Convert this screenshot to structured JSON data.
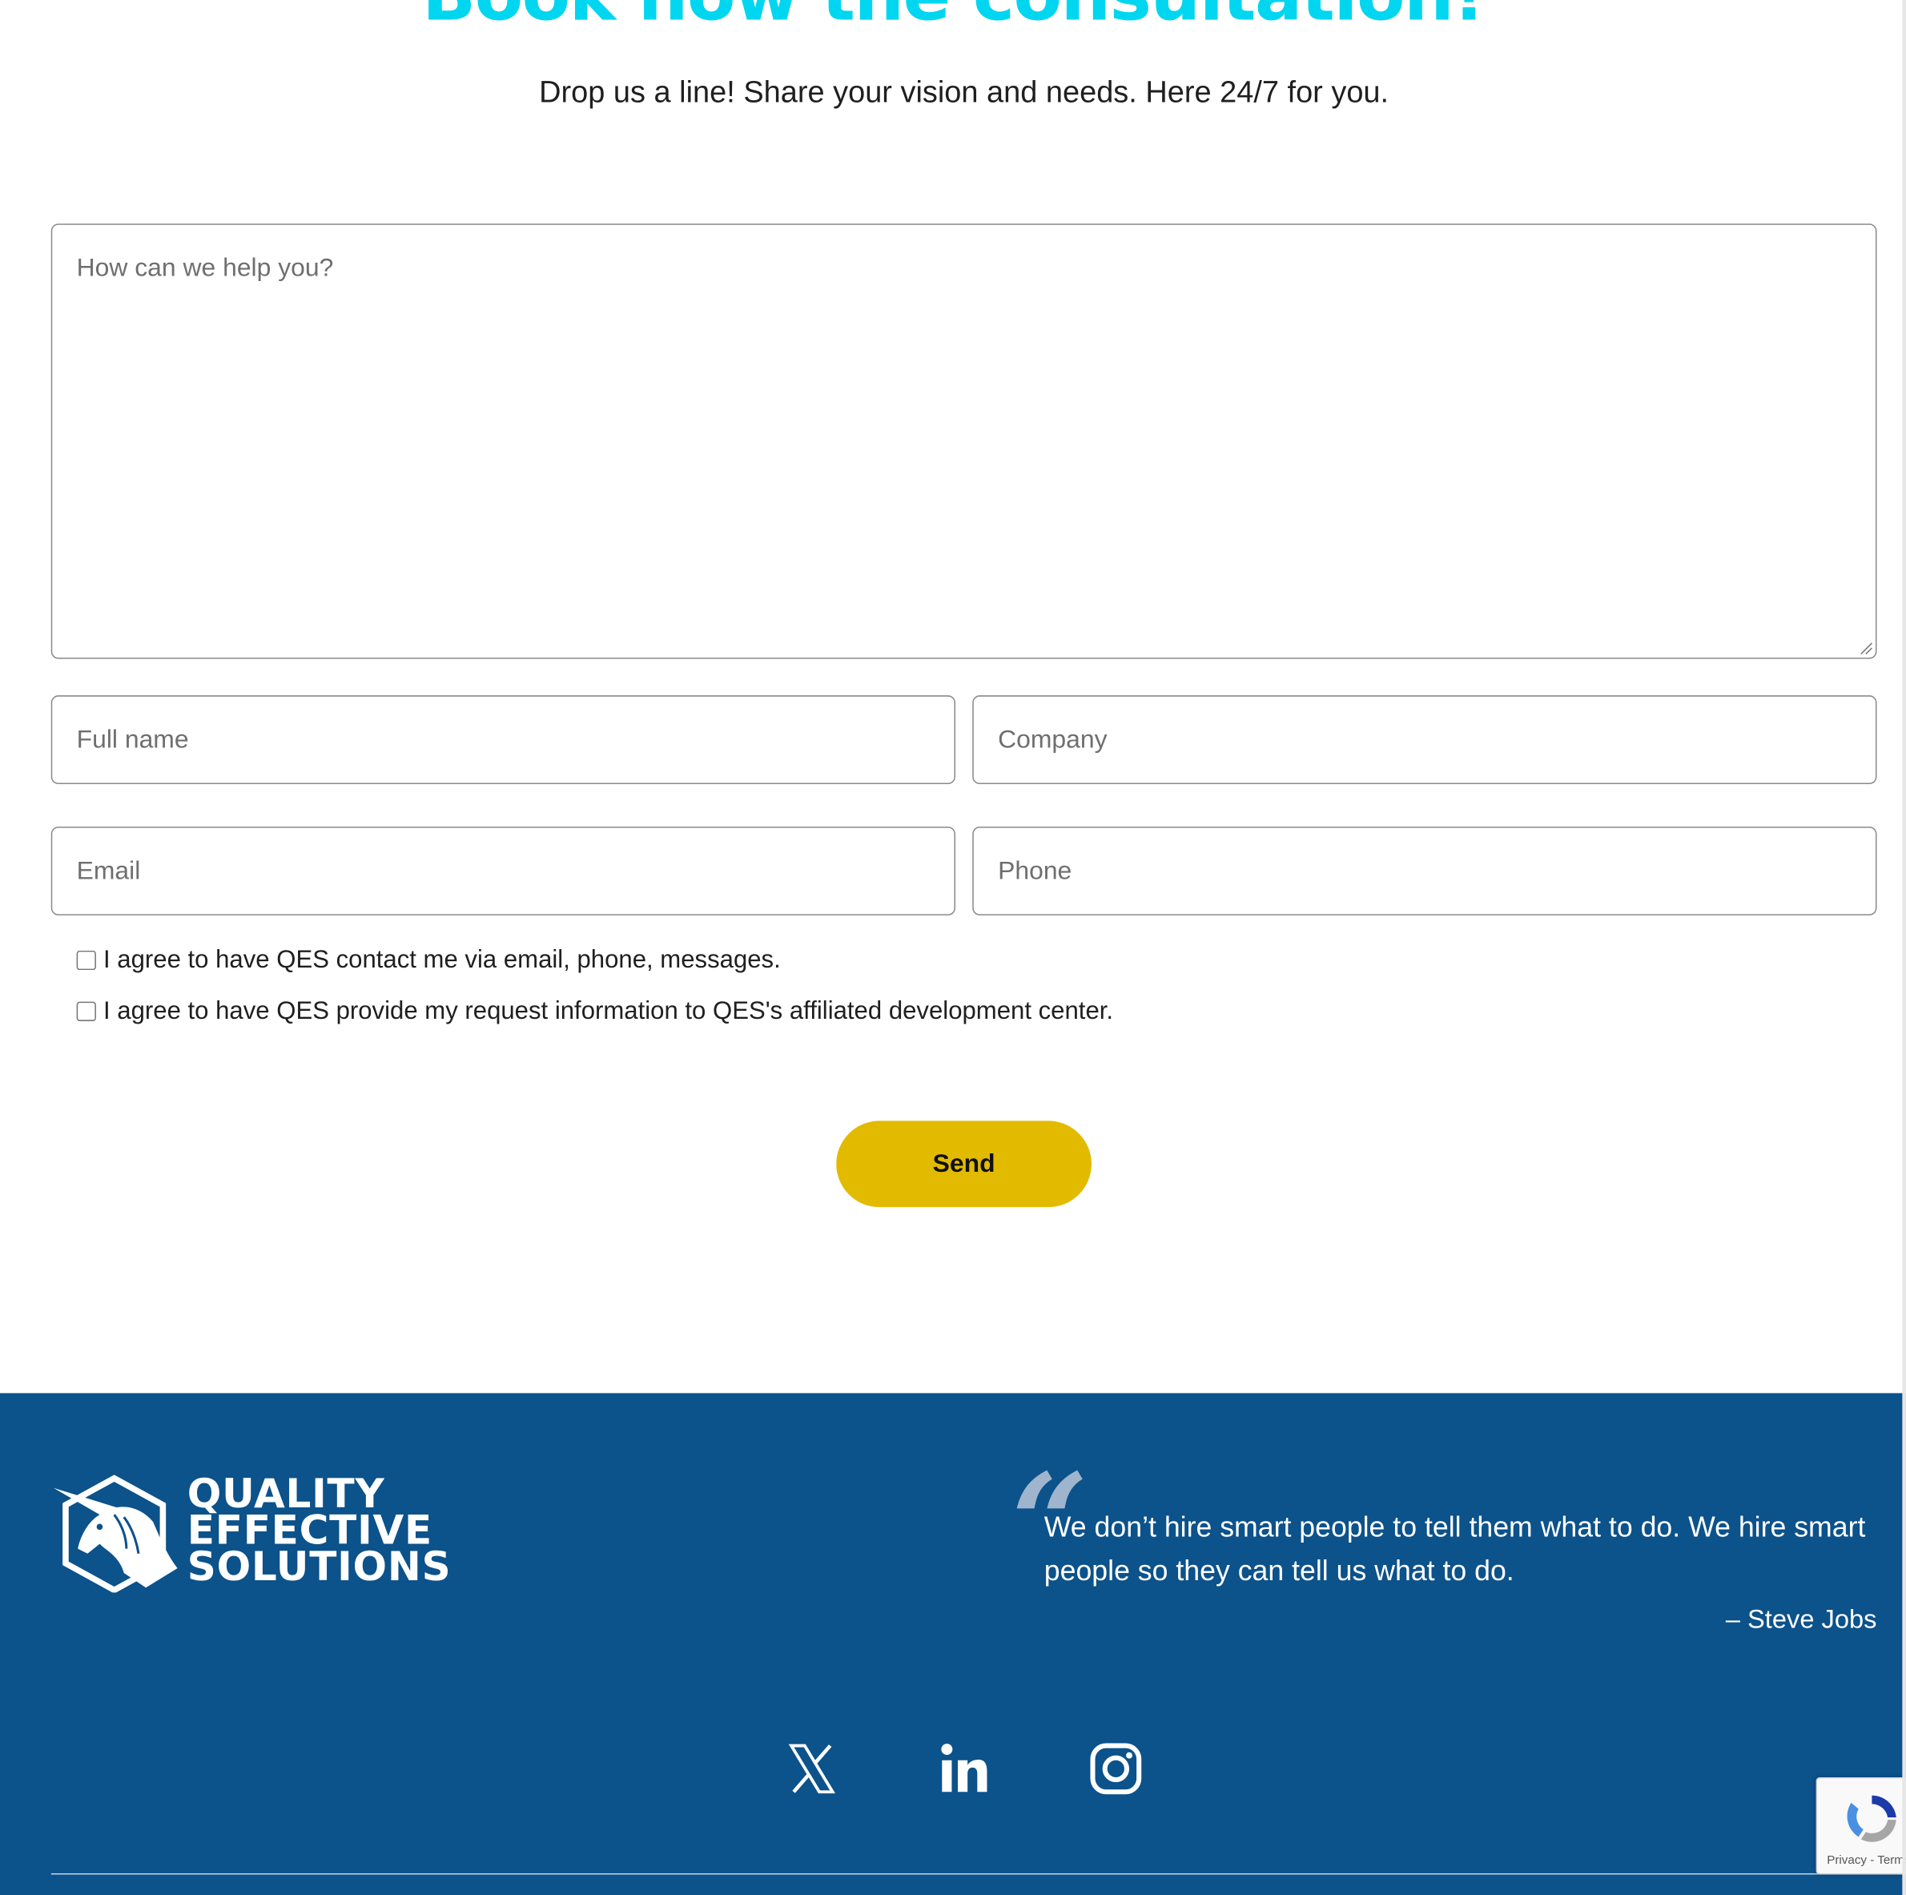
{
  "hero": {
    "title": "Book now the consultation!",
    "subtitle": "Drop us a line! Share your vision and needs. Here 24/7 for you."
  },
  "form": {
    "message_placeholder": "How can we help you?",
    "full_name_placeholder": "Full name",
    "company_placeholder": "Company",
    "email_placeholder": "Email",
    "phone_placeholder": "Phone",
    "consent_contact": "I agree to have QES contact me via email, phone, messages.",
    "consent_share": "I agree to have QES provide my request information to QES's affiliated development center.",
    "send_label": "Send"
  },
  "footer": {
    "logo_lines": [
      "QUALITY",
      "EFFECTIVE",
      "SOLUTIONS"
    ],
    "quote": "We don’t hire smart people to tell them what to do. We hire smart people so they can tell us what to do.",
    "quote_author": "– Steve Jobs",
    "social": [
      {
        "icon": "x-icon"
      },
      {
        "icon": "linkedin-icon"
      },
      {
        "icon": "instagram-icon"
      }
    ]
  },
  "recaptcha": {
    "links": "Privacy - Terms"
  },
  "colors": {
    "accent_cyan": "#00d6f0",
    "send_button": "#e2bb00",
    "footer_bg": "#0c528b"
  }
}
